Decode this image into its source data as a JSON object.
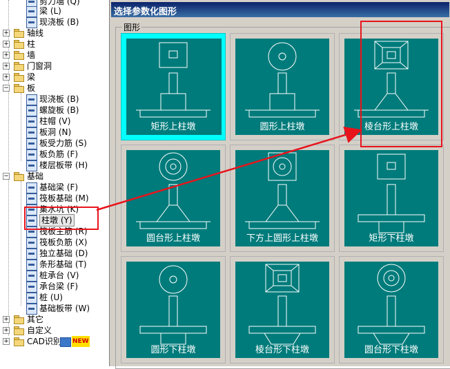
{
  "tree": {
    "items": [
      {
        "label": "剪力墙 (Q)",
        "icon": "shear-wall-icon"
      },
      {
        "label": "梁 (L)",
        "icon": "beam-icon"
      },
      {
        "label": "现浇板 (B)",
        "icon": "slab-icon"
      },
      {
        "label": "轴线",
        "toggle": "+"
      },
      {
        "label": "柱",
        "toggle": "+"
      },
      {
        "label": "墙",
        "toggle": "+"
      },
      {
        "label": "门窗洞",
        "toggle": "+"
      },
      {
        "label": "梁",
        "toggle": "+"
      },
      {
        "label": "板",
        "toggle": "-"
      },
      {
        "label": "现浇板 (B)",
        "icon": "slab-icon"
      },
      {
        "label": "螺旋板 (B)",
        "icon": "spiral-slab-icon"
      },
      {
        "label": "柱帽 (V)",
        "icon": "column-cap-icon"
      },
      {
        "label": "板洞 (N)",
        "icon": "slab-hole-icon"
      },
      {
        "label": "板受力筋 (S)",
        "icon": "slab-rebar-icon"
      },
      {
        "label": "板负筋 (F)",
        "icon": "negative-rebar-icon"
      },
      {
        "label": "楼层板带 (H)",
        "icon": "slab-strip-icon"
      },
      {
        "label": "基础",
        "toggle": "-"
      },
      {
        "label": "基础梁 (F)",
        "icon": "foundation-beam-icon"
      },
      {
        "label": "筏板基础 (M)",
        "icon": "raft-foundation-icon"
      },
      {
        "label": "集水坑 (K)",
        "icon": "sump-icon"
      },
      {
        "label": "柱墩 (Y)",
        "icon": "column-pier-icon",
        "selected": true
      },
      {
        "label": "筏板主筋 (R)",
        "icon": "raft-main-rebar-icon"
      },
      {
        "label": "筏板负筋 (X)",
        "icon": "raft-negative-rebar-icon"
      },
      {
        "label": "独立基础 (D)",
        "icon": "isolated-footing-icon"
      },
      {
        "label": "条形基础 (T)",
        "icon": "strip-footing-icon"
      },
      {
        "label": "桩承台 (V)",
        "icon": "pile-cap-icon"
      },
      {
        "label": "承台梁 (F)",
        "icon": "cap-beam-icon"
      },
      {
        "label": "桩 (U)",
        "icon": "pile-icon"
      },
      {
        "label": "基础板带 (W)",
        "icon": "foundation-strip-icon"
      },
      {
        "label": "其它",
        "toggle": "+"
      },
      {
        "label": "自定义",
        "toggle": "+"
      },
      {
        "label": "CAD识别",
        "toggle": "+",
        "badge": "NEW"
      }
    ]
  },
  "dialog": {
    "title": "选择参数化图形",
    "group_label": "图形",
    "tiles": [
      {
        "caption": "矩形上柱墩",
        "top": "square",
        "base": "rect",
        "selected": true
      },
      {
        "caption": "圆形上柱墩",
        "top": "circle",
        "base": "rect"
      },
      {
        "caption": "棱台形上柱墩",
        "top": "frustum-square",
        "base": "trapezoid"
      },
      {
        "caption": "圆台形上柱墩",
        "top": "double-circle",
        "base": "trapezoid"
      },
      {
        "caption": "下方上圆形上柱墩",
        "top": "square-circle",
        "base": "trapezoid"
      },
      {
        "caption": "矩形下柱墩",
        "top": "square",
        "base": "rect-down"
      },
      {
        "caption": "圆形下柱墩",
        "top": "circle",
        "base": "rect-down"
      },
      {
        "caption": "棱台形下柱墩",
        "top": "frustum-square",
        "base": "trapezoid-down"
      },
      {
        "caption": "圆台形下柱墩",
        "top": "double-circle",
        "base": "trapezoid-down"
      }
    ]
  },
  "colors": {
    "tile_face": "#007b7b",
    "selected_border": "#00ffff",
    "annotation": "#e8141c",
    "title_bar": "#0a246a"
  }
}
